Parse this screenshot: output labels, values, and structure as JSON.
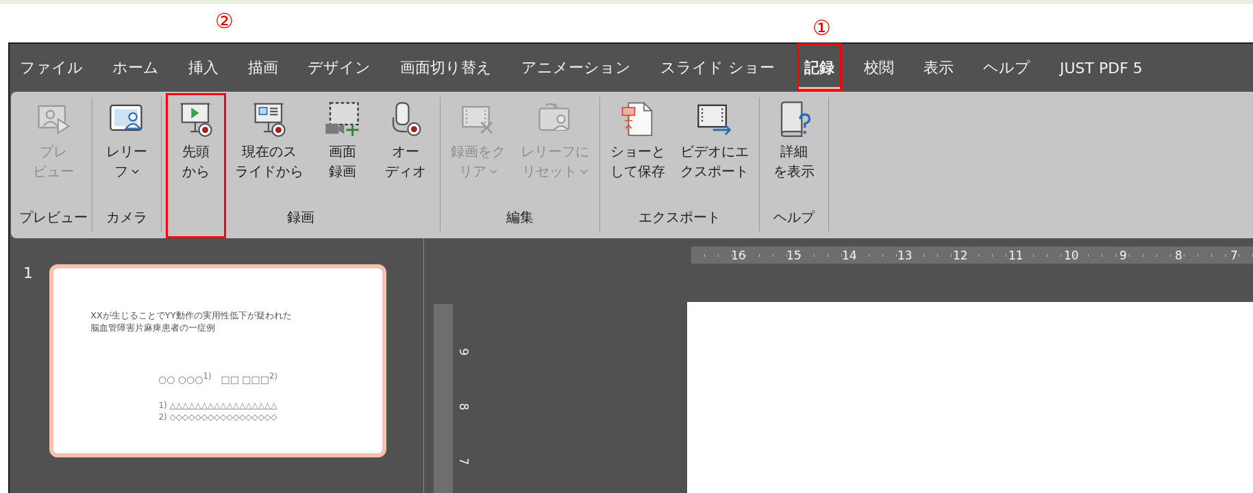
{
  "annotations": [
    {
      "label": "①"
    },
    {
      "label": "②"
    }
  ],
  "tabs": [
    {
      "label": "ファイル",
      "selected": false,
      "highlighted": false
    },
    {
      "label": "ホーム",
      "selected": false,
      "highlighted": false
    },
    {
      "label": "挿入",
      "selected": false,
      "highlighted": false
    },
    {
      "label": "描画",
      "selected": false,
      "highlighted": false
    },
    {
      "label": "デザイン",
      "selected": false,
      "highlighted": false
    },
    {
      "label": "画面切り替え",
      "selected": false,
      "highlighted": false
    },
    {
      "label": "アニメーション",
      "selected": false,
      "highlighted": false
    },
    {
      "label": "スライド ショー",
      "selected": false,
      "highlighted": false
    },
    {
      "label": "記録",
      "selected": true,
      "highlighted": true
    },
    {
      "label": "校閲",
      "selected": false,
      "highlighted": false
    },
    {
      "label": "表示",
      "selected": false,
      "highlighted": false
    },
    {
      "label": "ヘルプ",
      "selected": false,
      "highlighted": false
    },
    {
      "label": "JUST PDF 5",
      "selected": false,
      "highlighted": false
    }
  ],
  "ribbon": {
    "groups": [
      {
        "label": "プレビュー",
        "buttons": [
          {
            "lines": [
              "プレ",
              "ビュー"
            ],
            "disabled": true,
            "dropdown": false,
            "highlighted": false
          }
        ]
      },
      {
        "label": "カメラ",
        "buttons": [
          {
            "lines": [
              "レリー",
              "フ"
            ],
            "disabled": false,
            "dropdown": true,
            "highlighted": false
          }
        ]
      },
      {
        "label": "録画",
        "buttons": [
          {
            "lines": [
              "先頭",
              "から"
            ],
            "disabled": false,
            "dropdown": false,
            "highlighted": true
          },
          {
            "lines": [
              "現在のス",
              "ライドから"
            ],
            "disabled": false,
            "dropdown": false,
            "highlighted": false
          },
          {
            "lines": [
              "画面",
              "録画"
            ],
            "disabled": false,
            "dropdown": false,
            "highlighted": false
          },
          {
            "lines": [
              "オー",
              "ディオ"
            ],
            "disabled": false,
            "dropdown": false,
            "highlighted": false
          }
        ]
      },
      {
        "label": "編集",
        "buttons": [
          {
            "lines": [
              "録画をク",
              "リア"
            ],
            "disabled": true,
            "dropdown": true,
            "highlighted": false
          },
          {
            "lines": [
              "レリーフに",
              "リセット"
            ],
            "disabled": true,
            "dropdown": true,
            "highlighted": false
          }
        ]
      },
      {
        "label": "エクスポート",
        "buttons": [
          {
            "lines": [
              "ショーと",
              "して保存"
            ],
            "disabled": false,
            "dropdown": false,
            "highlighted": false
          },
          {
            "lines": [
              "ビデオにエ",
              "クスポート"
            ],
            "disabled": false,
            "dropdown": false,
            "highlighted": false
          }
        ]
      },
      {
        "label": "ヘルプ",
        "buttons": [
          {
            "lines": [
              "詳細",
              "を表示"
            ],
            "disabled": false,
            "dropdown": false,
            "highlighted": false
          }
        ]
      }
    ]
  },
  "slides": [
    {
      "number": "1",
      "selected": true,
      "title_lines": [
        "XXが生じることでYY動作の実用性低下が疑われた",
        "脳血管障害片麻痺患者の一症例"
      ],
      "authors": "○○ ○○○$^{1)}$　□□ □□□$^{2)}$",
      "references": [
        "1) △△△△△△△△△△△△△△△△△",
        "2) ◇◇◇◇◇◇◇◇◇◇◇◇◇◇◇◇◇"
      ]
    }
  ],
  "horizontal_ruler": [
    "16",
    "15",
    "14",
    "13",
    "12",
    "11",
    "10",
    "9",
    "8",
    "7"
  ],
  "vertical_ruler": [
    "9",
    "8",
    "7"
  ]
}
